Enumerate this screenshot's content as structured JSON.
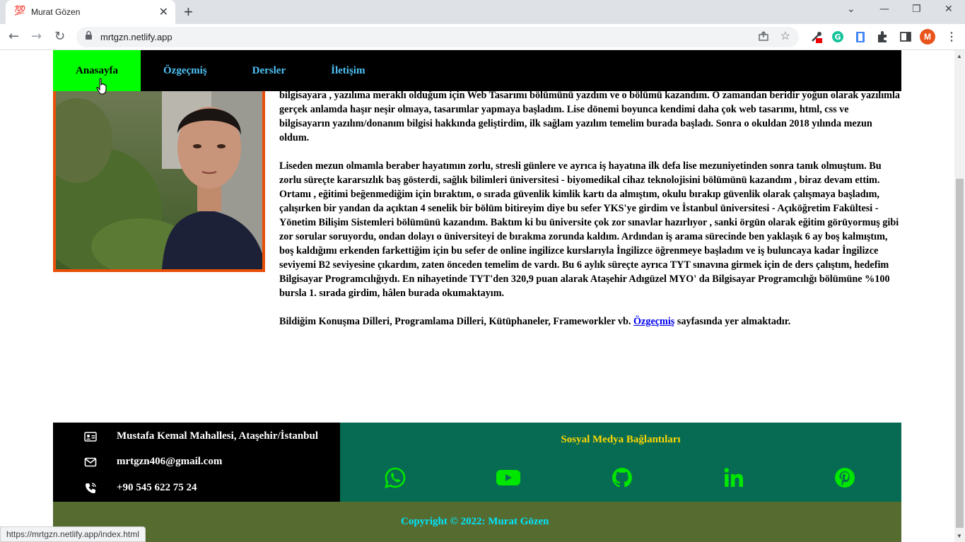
{
  "browser": {
    "tab_title": "Murat Gözen",
    "tab_favicon": "💯",
    "url": "mrtgzn.netlify.app",
    "profile_initial": "M",
    "status_url": "https://mrtgzn.netlify.app/index.html"
  },
  "nav": {
    "items": [
      {
        "label": "Anasayfa",
        "active": true
      },
      {
        "label": "Özgeçmiş",
        "active": false
      },
      {
        "label": "Dersler",
        "active": false
      },
      {
        "label": "İletişim",
        "active": false
      }
    ]
  },
  "article": {
    "p1": "bilgisayara , yazılıma meraklı olduğum için Web Tasarımı bölümünü yazdım ve o bölümü kazandım. O zamandan beridir yoğun olarak yazılımla gerçek anlamda haşır neşir olmaya, tasarımlar yapmaya başladım. Lise dönemi boyunca kendimi daha çok web tasarımı, html, css ve bilgisayarın yazılım/donanım bilgisi hakkında geliştirdim, ilk sağlam yazılım temelim burada başladı. Sonra o okuldan 2018 yılında mezun oldum.",
    "p2": "Liseden mezun olmamla beraber hayatımın zorlu, stresli günlere ve ayrıca iş hayatına ilk defa lise mezuniyetinden sonra tanık olmuştum. Bu zorlu süreçte kararsızlık baş gösterdi, sağlık bilimleri üniversitesi - biyomedikal cihaz teknolojisini bölümünü kazandım , biraz devam ettim. Ortamı , eğitimi beğenmediğim için bıraktım, o sırada güvenlik kimlik kartı da almıştım, okulu bırakıp güvenlik olarak çalışmaya başladım, çalışırken bir yandan da açıktan 4 senelik bir bölüm bitireyim diye bu sefer YKS'ye girdim ve İstanbul üniversitesi - Açıköğretim Fakültesi - Yönetim Bilişim Sistemleri bölümünü kazandım. Baktım ki bu üniversite çok zor sınavlar hazırlıyor , sanki örgün olarak eğitim görüyormuş gibi zor sorular soruyordu, ondan dolayı o üniversiteyi de bırakma zorunda kaldım. Ardından iş arama sürecinde ben yaklaşık 6 ay boş kalmıştım, boş kaldığımı erkenden farkettiğim için bu sefer de online ingilizce kurslarıyla İngilizce öğrenmeye başladım ve iş buluncaya kadar İngilizce seviyemi B2 seviyesine çıkardım, zaten önceden temelim de vardı. Bu 6 aylık süreçte ayrıca TYT sınavına girmek için de ders çalıştım, hedefim Bilgisayar Programcılığıydı. En nihayetinde TYT'den 320,9 puan alarak Ataşehir Adıgüzel MYO' da Bilgisayar Programcılığı bölümüne %100 bursla 1. sırada girdim, hâlen burada okumaktayım.",
    "p3_before": "Bildiğim Konuşma Dilleri, Programlama Dilleri, Kütüphaneler, Frameworkler vb. ",
    "p3_link": "Özgeçmiş",
    "p3_after": " sayfasında yer almaktadır."
  },
  "contact": {
    "address": "Mustafa Kemal Mahallesi, Ataşehir/İstanbul",
    "email": "mrtgzn406@gmail.com",
    "phone": "+90 545 622 75 24"
  },
  "social": {
    "heading": "Sosyal Medya Bağlantıları",
    "icons": [
      "whatsapp-icon",
      "youtube-icon",
      "github-icon",
      "linkedin-icon",
      "pinterest-icon"
    ],
    "icon_color": "#00e600"
  },
  "footer": {
    "copyright": "Copyright © 2022: Murat Gözen"
  },
  "colors": {
    "nav_active": "#00ff00",
    "nav_link": "#4fc3f7",
    "photo_border": "#e8500a",
    "social_bg": "#076b53",
    "heading": "#ffd700",
    "footer_bg": "#556b2f",
    "footer_text": "#00e5ff"
  }
}
